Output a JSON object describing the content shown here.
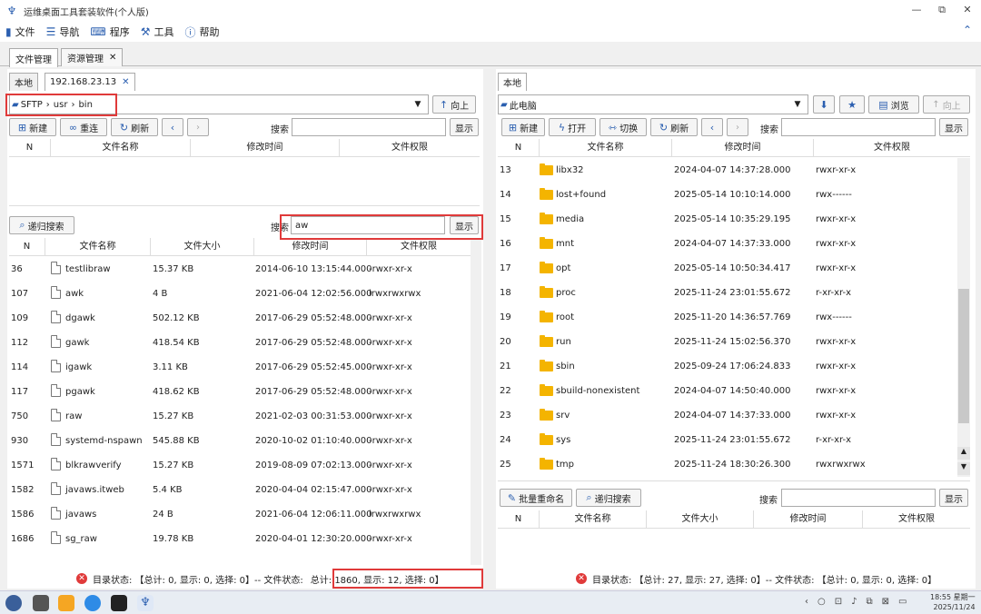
{
  "window": {
    "title": "运维桌面工具套装软件(个人版)",
    "minimize": "—",
    "restore": "⧉",
    "close": "✕"
  },
  "menu": [
    {
      "label": "文件",
      "icon": "file-icon"
    },
    {
      "label": "导航",
      "icon": "menu-icon"
    },
    {
      "label": "程序",
      "icon": "keyboard-icon"
    },
    {
      "label": "工具",
      "icon": "toolbox-icon"
    },
    {
      "label": "帮助",
      "icon": "help-icon"
    }
  ],
  "tabs": [
    {
      "label": "文件管理"
    },
    {
      "label": "资源管理"
    }
  ],
  "left": {
    "subtabs": [
      "本地",
      "192.168.23.13"
    ],
    "path": {
      "root": "SFTP",
      "parts": [
        "usr",
        "bin"
      ]
    },
    "up_label": "向上",
    "toolbar": {
      "new": "新建",
      "reconnect": "重连",
      "refresh": "刷新",
      "search_label": "搜索",
      "search_value": "",
      "show": "显示"
    },
    "dir_headers": [
      "N",
      "文件名称",
      "修改时间",
      "文件权限"
    ],
    "recursive": {
      "button": "递归搜索",
      "search_label": "搜索",
      "search_value": "aw",
      "show": "显示"
    },
    "file_headers": [
      "N",
      "文件名称",
      "文件大小",
      "修改时间",
      "文件权限"
    ],
    "files": [
      {
        "n": "36",
        "name": "testlibraw",
        "size": "15.37 KB",
        "time": "2014-06-10 13:15:44.000",
        "perm": "-rwxr-xr-x"
      },
      {
        "n": "107",
        "name": "awk",
        "size": "4 B",
        "time": "2021-06-04 12:02:56.000",
        "perm": "lrwxrwxrwx"
      },
      {
        "n": "109",
        "name": "dgawk",
        "size": "502.12 KB",
        "time": "2017-06-29 05:52:48.000",
        "perm": "-rwxr-xr-x"
      },
      {
        "n": "112",
        "name": "gawk",
        "size": "418.54 KB",
        "time": "2017-06-29 05:52:48.000",
        "perm": "-rwxr-xr-x"
      },
      {
        "n": "114",
        "name": "igawk",
        "size": "3.11 KB",
        "time": "2017-06-29 05:52:45.000",
        "perm": "-rwxr-xr-x"
      },
      {
        "n": "117",
        "name": "pgawk",
        "size": "418.62 KB",
        "time": "2017-06-29 05:52:48.000",
        "perm": "-rwxr-xr-x"
      },
      {
        "n": "750",
        "name": "raw",
        "size": "15.27 KB",
        "time": "2021-02-03 00:31:53.000",
        "perm": "-rwxr-xr-x"
      },
      {
        "n": "930",
        "name": "systemd-nspawn",
        "size": "545.88 KB",
        "time": "2020-10-02 01:10:40.000",
        "perm": "-rwxr-xr-x"
      },
      {
        "n": "1571",
        "name": "blkrawverify",
        "size": "15.27 KB",
        "time": "2019-08-09 07:02:13.000",
        "perm": "-rwxr-xr-x"
      },
      {
        "n": "1582",
        "name": "javaws.itweb",
        "size": "5.4 KB",
        "time": "2020-04-04 02:15:47.000",
        "perm": "-rwxr-xr-x"
      },
      {
        "n": "1586",
        "name": "javaws",
        "size": "24 B",
        "time": "2021-06-04 12:06:11.000",
        "perm": "lrwxrwxrwx"
      },
      {
        "n": "1686",
        "name": "sg_raw",
        "size": "19.78 KB",
        "time": "2020-04-01 12:30:20.000",
        "perm": "-rwxr-xr-x"
      }
    ],
    "status": {
      "dir": "目录状态: 【总计: 0, 显示: 0, 选择: 0】-- 文件状态: ",
      "file": "总计: 1860, 显示: 12, 选择: 0】"
    }
  },
  "right": {
    "subtabs": [
      "本地"
    ],
    "path": "此电脑",
    "browse": "浏览",
    "up_label": "向上",
    "toolbar": {
      "new": "新建",
      "open": "打开",
      "switch": "切换",
      "refresh": "刷新",
      "search_label": "搜索",
      "search_value": "",
      "show": "显示"
    },
    "dir_headers": [
      "N",
      "文件名称",
      "修改时间",
      "文件权限"
    ],
    "dirs": [
      {
        "n": "13",
        "name": "libx32",
        "time": "2024-04-07 14:37:28.000",
        "perm": "rwxr-xr-x"
      },
      {
        "n": "14",
        "name": "lost+found",
        "time": "2025-05-14 10:10:14.000",
        "perm": "rwx------"
      },
      {
        "n": "15",
        "name": "media",
        "time": "2025-05-14 10:35:29.195",
        "perm": "rwxr-xr-x"
      },
      {
        "n": "16",
        "name": "mnt",
        "time": "2024-04-07 14:37:33.000",
        "perm": "rwxr-xr-x"
      },
      {
        "n": "17",
        "name": "opt",
        "time": "2025-05-14 10:50:34.417",
        "perm": "rwxr-xr-x"
      },
      {
        "n": "18",
        "name": "proc",
        "time": "2025-11-24 23:01:55.672",
        "perm": "r-xr-xr-x"
      },
      {
        "n": "19",
        "name": "root",
        "time": "2025-11-20 14:36:57.769",
        "perm": "rwx------"
      },
      {
        "n": "20",
        "name": "run",
        "time": "2025-11-24 15:02:56.370",
        "perm": "rwxr-xr-x"
      },
      {
        "n": "21",
        "name": "sbin",
        "time": "2025-09-24 17:06:24.833",
        "perm": "rwxr-xr-x"
      },
      {
        "n": "22",
        "name": "sbuild-nonexistent",
        "time": "2024-04-07 14:50:40.000",
        "perm": "rwxr-xr-x"
      },
      {
        "n": "23",
        "name": "srv",
        "time": "2024-04-07 14:37:33.000",
        "perm": "rwxr-xr-x"
      },
      {
        "n": "24",
        "name": "sys",
        "time": "2025-11-24 23:01:55.672",
        "perm": "r-xr-xr-x"
      },
      {
        "n": "25",
        "name": "tmp",
        "time": "2025-11-24 18:30:26.300",
        "perm": "rwxrwxrwx"
      }
    ],
    "rename": "批量重命名",
    "recursive": {
      "button": "递归搜索",
      "search_label": "搜索",
      "search_value": "",
      "show": "显示"
    },
    "file_headers": [
      "N",
      "文件名称",
      "文件大小",
      "修改时间",
      "文件权限"
    ],
    "status": "目录状态: 【总计: 27, 显示: 27, 选择: 0】-- 文件状态: 【总计: 0, 显示: 0, 选择: 0】"
  },
  "taskbar": {
    "time": "18:55 星期一",
    "date": "2025/11/24"
  }
}
